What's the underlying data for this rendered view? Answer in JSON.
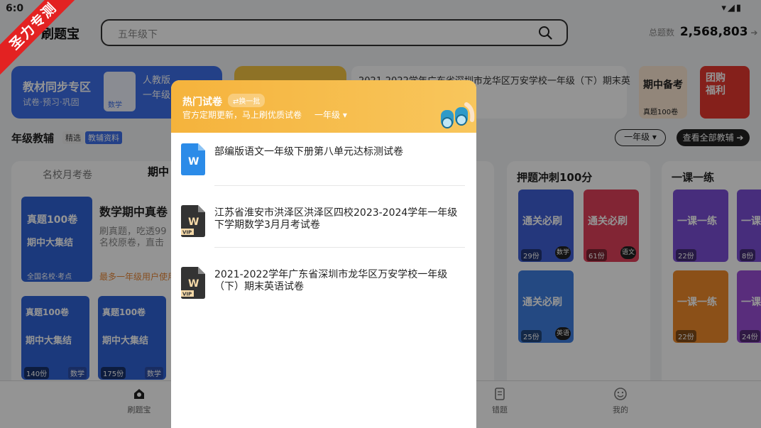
{
  "status": {
    "time": "6:0",
    "icons": "▾◢▮"
  },
  "header": {
    "app_name": "刷题宝",
    "search_placeholder": "五年级下",
    "total_label": "总题数",
    "total_value": "2,568,803",
    "total_arrow": "➔"
  },
  "banners": {
    "sync_title": "教材同步专区",
    "sync_sub": "试卷·预习·巩固",
    "sync_book_label": "数学",
    "sync_edition": "人教版",
    "sync_grade": "一年级",
    "news": "2021-2022学年广东省深圳市龙华区万安学校一年级（下）期末英",
    "promo1_title": "期中备考",
    "promo1_sub": "真题100卷",
    "promo2_title": "团购福利"
  },
  "section": {
    "title": "年级教辅",
    "tag_select": "精选",
    "tag_aux": "教辅资料",
    "grade_btn": "一年级 ▾",
    "all_btn": "查看全部教辅 ➔"
  },
  "left_panel": {
    "tab1": "名校月考卷",
    "tab2": "期中",
    "cover_title": "真题100卷",
    "cover_sub": "期中大集结",
    "cover_foot": "全国名校·考点",
    "math_title": "数学期中真卷",
    "math_sub1": "刷真题，吃透99",
    "math_sub2": "名校原卷，直击",
    "math_users": "最多一年级用户使用",
    "small_covers": [
      {
        "title": "真题100卷",
        "sub": "期中大集结",
        "count": "140份",
        "subject": "数学"
      },
      {
        "title": "真题100卷",
        "sub": "期中大集结",
        "count": "175份",
        "subject": "数学"
      }
    ]
  },
  "mid_panel": {
    "title": "押题冲刺100分",
    "books": [
      {
        "title": "通关必刷",
        "count": "29份",
        "subject": "数学",
        "color": "#3f5fd6"
      },
      {
        "title": "通关必刷",
        "count": "61份",
        "subject": "语文",
        "color": "#e0405a"
      },
      {
        "title": "通关必刷",
        "count": "25份",
        "subject": "英语",
        "color": "#3f7fe0"
      }
    ]
  },
  "right_panel": {
    "title": "一课一练",
    "books": [
      {
        "title": "一课一练",
        "count": "22份",
        "color": "#7a4fd6"
      },
      {
        "title": "一课一练",
        "count": "8份",
        "color": "#7a4fd6"
      },
      {
        "title": "一课一练",
        "count": "22份",
        "color": "#f08a2a"
      },
      {
        "title": "一课一练",
        "count": "24份",
        "color": "#9a4fd6"
      }
    ]
  },
  "bottom_nav": [
    {
      "label": "刷题宝"
    },
    {
      "label": "错题"
    },
    {
      "label": "我的"
    }
  ],
  "ribbon": "圣力专测",
  "popup": {
    "title": "热门试卷",
    "refresh": "⇄换一批",
    "subtitle": "官方定期更新，马上刷优质试卷",
    "grade": "一年级 ▾",
    "papers": [
      {
        "title": "部编版语文一年级下册第八单元达标测试卷",
        "vip": false
      },
      {
        "title": "江苏省淮安市洪泽区洪泽区四校2023-2024学年一年级下学期数学3月月考试卷",
        "vip": true
      },
      {
        "title": "2021-2022学年广东省深圳市龙华区万安学校一年级（下）期末英语试卷",
        "vip": true
      }
    ],
    "vip_label": "VIP",
    "doc_glyph": "W"
  },
  "colors": {
    "accent": "#3d6fe8",
    "popup_header": "#f5b33c",
    "doc_blue": "#2b8be8",
    "doc_dark": "#333333"
  }
}
